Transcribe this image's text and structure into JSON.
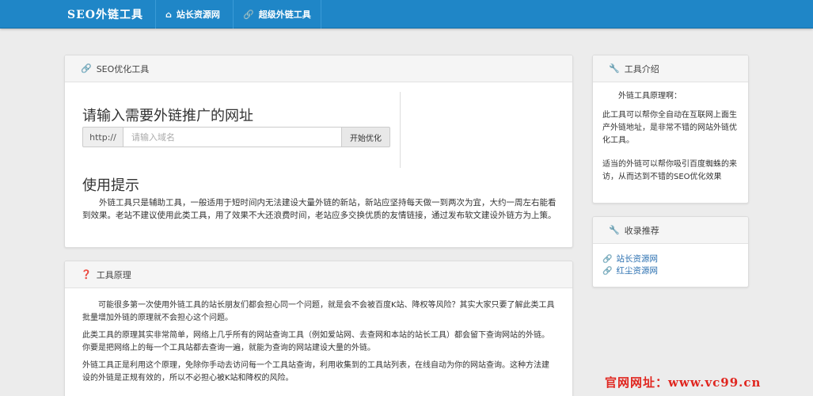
{
  "nav": {
    "brand": "SEO外链工具",
    "items": [
      {
        "label": "站长资源网",
        "icon": "home-icon"
      },
      {
        "label": "超级外链工具",
        "icon": "link-icon"
      }
    ]
  },
  "main_panel": {
    "header": "SEO优化工具",
    "title": "请输入需要外链推广的网址",
    "prefix": "http://",
    "placeholder": "请输入域名",
    "button": "开始优化",
    "tips_title": "使用提示",
    "tips_text": "外链工具只是辅助工具，一般适用于短时间内无法建设大量外链的新站，新站应坚持每天做一到两次为宜，大约一周左右能看到效果。老站不建议使用此类工具，用了效果不大还浪费时间，老站应多交换优质的友情链接，通过发布软文建设外链方为上策。"
  },
  "principle_panel": {
    "header": "工具原理",
    "paragraphs": [
      "可能很多第一次使用外链工具的站长朋友们都会担心同一个问题，就是会不会被百度K站、降权等风险？其实大家只要了解此类工具批量增加外链的原理就不会担心这个问题。",
      "此类工具的原理其实非常简单，网络上几乎所有的网站查询工具（例如爱站网、去查网和本站的站长工具）都会留下查询网站的外链。你要是把网络上的每一个工具站都去查询一遍，就能为查询的网站建设大量的外链。",
      "外链工具正是利用这个原理，免除你手动去访问每一个工具站查询，利用收集到的工具站列表，在线自动为你的网站查询。这种方法建设的外链是正规有效的，所以不必担心被K站和降权的风险。"
    ]
  },
  "intro_panel": {
    "header": "工具介绍",
    "lead": "外链工具原理啊：",
    "p1": "此工具可以帮你全自动在互联网上面生产外链地址，是非常不错的网站外链优化工具。",
    "p2": "适当的外链可以帮你吸引百度蜘蛛的来访，从而达到不错的SEO优化效果"
  },
  "rec_panel": {
    "header": "收录推荐",
    "links": [
      "站长资源网",
      "红尘资源网"
    ]
  },
  "watermark": "官网网址：www.vc99.cn",
  "colors": {
    "nav_bg": "#1f86c7",
    "link": "#2a6fb0",
    "watermark": "#e0261f"
  }
}
